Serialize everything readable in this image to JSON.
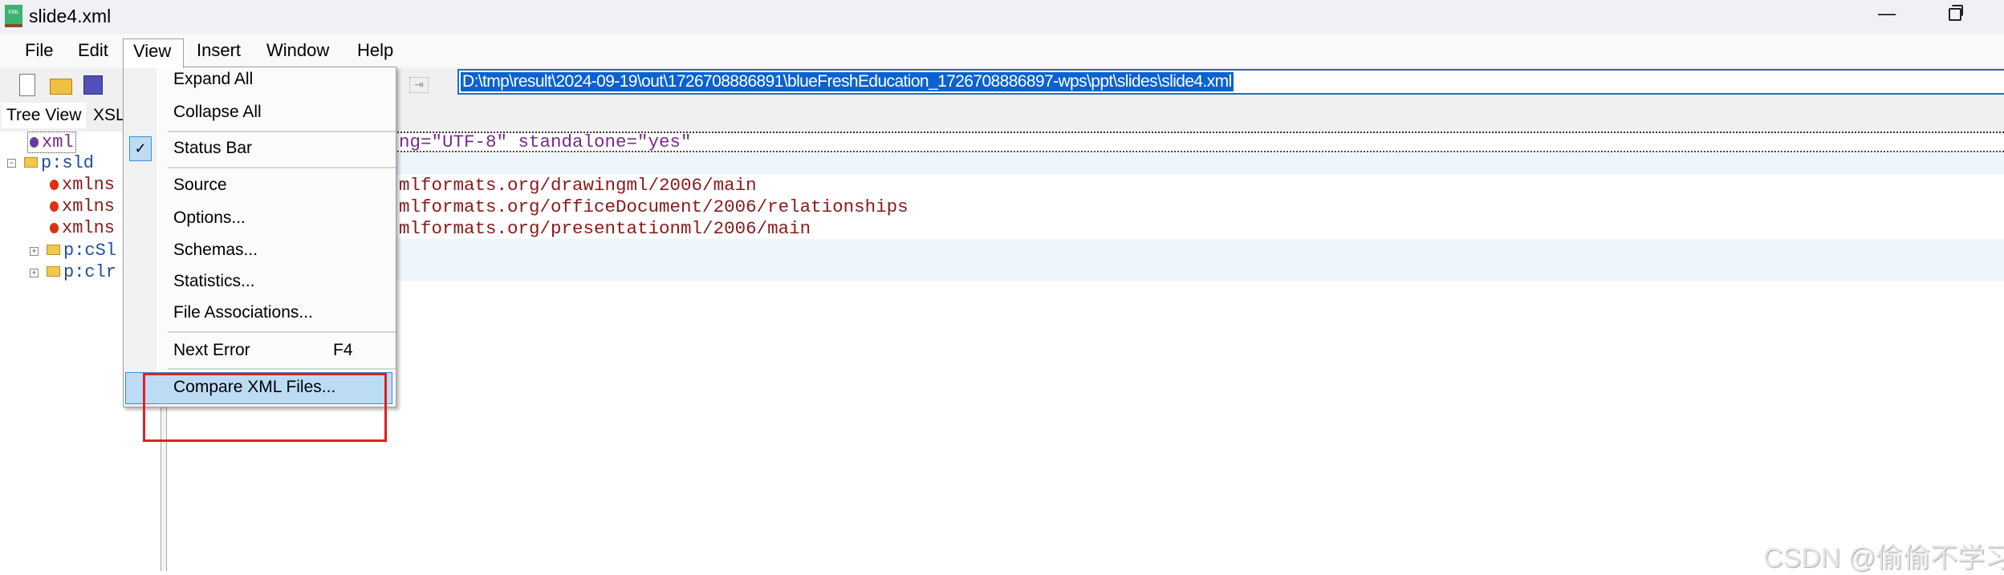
{
  "window": {
    "title": "slide4.xml",
    "icon": "xml-file-icon"
  },
  "menubar": {
    "items": [
      "File",
      "Edit",
      "View",
      "Insert",
      "Window",
      "Help"
    ],
    "open": "View"
  },
  "toolbar": {
    "icons": [
      "new-file-icon",
      "open-folder-icon",
      "save-icon",
      "go-icon"
    ],
    "address": "D:\\tmp\\result\\2024-09-19\\out\\1726708886891\\blueFreshEducation_1726708886897-wps\\ppt\\slides\\slide4.xml"
  },
  "tabs": [
    "Tree View",
    "XSL"
  ],
  "tree": {
    "nodes": [
      "xml",
      "p:sld",
      "xmlns",
      "xmlns",
      "xmlns",
      "p:cSl",
      "p:clr"
    ]
  },
  "editor": {
    "lines": [
      "ng=\"UTF-8\" standalone=\"yes\"",
      "mlformats.org/drawingml/2006/main",
      "mlformats.org/officeDocument/2006/relationships",
      "mlformats.org/presentationml/2006/main"
    ]
  },
  "view_menu": {
    "items": [
      {
        "label": "Expand All"
      },
      {
        "label": "Collapse All"
      },
      {
        "label": "Status Bar",
        "checked": true
      },
      {
        "label": "Source"
      },
      {
        "label": "Options..."
      },
      {
        "label": "Schemas..."
      },
      {
        "label": "Statistics..."
      },
      {
        "label": "File Associations..."
      },
      {
        "label": "Next Error",
        "shortcut": "F4"
      },
      {
        "label": "Compare XML Files...",
        "highlighted": true
      }
    ]
  },
  "annotation": {
    "color": "#e02020"
  },
  "watermark": "CSDN @偷偷不学习",
  "colors": {
    "selection": "#0a62d0",
    "menu_highlight": "#bcdcf4",
    "attr_value": "#8b1a1a",
    "decl": "#7a2a8a",
    "element": "#1f4fa0"
  }
}
